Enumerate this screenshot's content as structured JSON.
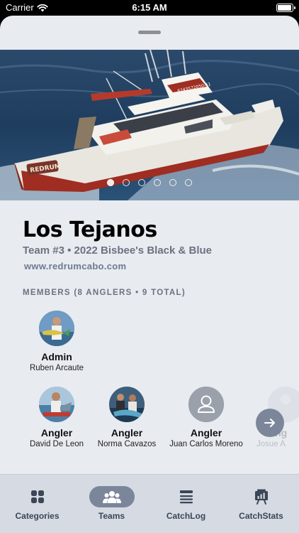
{
  "status": {
    "carrier": "Carrier",
    "time": "6:15 AM",
    "battery_level": 1.0
  },
  "hero": {
    "boat_name": "REDRUM",
    "boat_phone": "6243572050-51",
    "page_count": 6,
    "active_page": 0
  },
  "team": {
    "name": "Los Tejanos",
    "subtitle": "Team #3 • 2022 Bisbee's Black & Blue",
    "url": "www.redrumcabo.com"
  },
  "members_heading": "MEMBERS (8 ANGLERS • 9 TOTAL)",
  "members": [
    {
      "role": "Admin",
      "name": "Ruben Arcaute",
      "avatar": "photo"
    },
    {
      "role": "Angler",
      "name": "David De Leon",
      "avatar": "photo"
    },
    {
      "role": "Angler",
      "name": "Norma Cavazos",
      "avatar": "photo"
    },
    {
      "role": "Angler",
      "name": "Juan Carlos Moreno",
      "avatar": "person-placeholder-icon"
    },
    {
      "role": "Ang",
      "name": "Josue A",
      "avatar": "photo"
    }
  ],
  "next_button": {
    "icon": "arrow-right-icon"
  },
  "tabs": [
    {
      "label": "Categories",
      "icon": "grid-icon",
      "active": false
    },
    {
      "label": "Teams",
      "icon": "people-icon",
      "active": true
    },
    {
      "label": "CatchLog",
      "icon": "list-icon",
      "active": false
    },
    {
      "label": "CatchStats",
      "icon": "chart-board-icon",
      "active": false
    }
  ],
  "colors": {
    "sheet_bg": "#e8ebf0",
    "accent": "#7b869a",
    "tabbar_bg": "#d5dae3",
    "muted_text": "#6b7280"
  }
}
